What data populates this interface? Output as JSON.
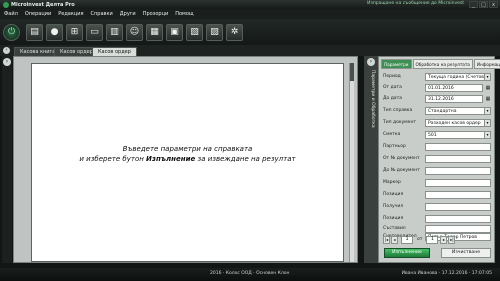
{
  "window": {
    "title": "Microinvest Делта Pro",
    "notice": "Изпращане на съобщение до Microinvest",
    "controls": [
      "_",
      "□",
      "x"
    ]
  },
  "menu": [
    "Файл",
    "Операции",
    "Редакция",
    "Справки",
    "Други",
    "Прозорци",
    "Помощ"
  ],
  "toolbar_icons": [
    "power-icon",
    "document-icon",
    "coins-icon",
    "cart-icon",
    "cash-icon",
    "building-icon",
    "people-icon",
    "invoice-icon",
    "lock-icon",
    "report-icon",
    "printer-icon",
    "settings-icon"
  ],
  "tabs": [
    "Касова книга",
    "Касов ордер",
    "Касов ордер"
  ],
  "report": {
    "message_line1": "Въведете параметри на справката",
    "message_line2_pre": "и изберете бутон ",
    "message_line2_bold": "Изпълнение",
    "message_line2_post": " за извеждане на резултат"
  },
  "side_strip_label": "Параметри и Обработка",
  "right_panel": {
    "tabs": [
      "Параметри",
      "Обработка на резултата",
      "Информация"
    ],
    "fields": [
      {
        "label": "Период",
        "value": "Текуща година (Счетоводна)",
        "type": "select"
      },
      {
        "label": "От дата",
        "value": "01.01.2016",
        "type": "date"
      },
      {
        "label": "До дата",
        "value": "31.12.2016",
        "type": "date"
      },
      {
        "label": "Тип справка",
        "value": "Стандартна",
        "type": "select"
      },
      {
        "label": "Тип документ",
        "value": "Разходен касов ордер",
        "type": "select"
      },
      {
        "label": "Сметка",
        "value": "501",
        "type": "select"
      },
      {
        "label": "Партньор",
        "value": "",
        "type": "text"
      },
      {
        "label": "От № документ",
        "value": "",
        "type": "text"
      },
      {
        "label": "До № документ",
        "value": "",
        "type": "text"
      },
      {
        "label": "Маркер",
        "value": "",
        "type": "text"
      },
      {
        "label": "Позиция",
        "value": "",
        "type": "text"
      },
      {
        "label": "Получил",
        "value": "",
        "type": "text"
      },
      {
        "label": "Позиция",
        "value": "",
        "type": "text"
      },
      {
        "label": "Съставил",
        "value": "",
        "type": "text"
      },
      {
        "label": "Счетоводител",
        "value": "Петър Тодор Петров",
        "type": "text"
      }
    ],
    "pager": {
      "current": "1",
      "of_label": "от",
      "total": "1"
    },
    "run_button": "Изпълнение",
    "clear_button": "Изчистване"
  },
  "status": {
    "center": "2016 · Колос ООД · Основен Клон",
    "right": "Ивана Иванова · 17.12.2016 · 17:07:05"
  }
}
